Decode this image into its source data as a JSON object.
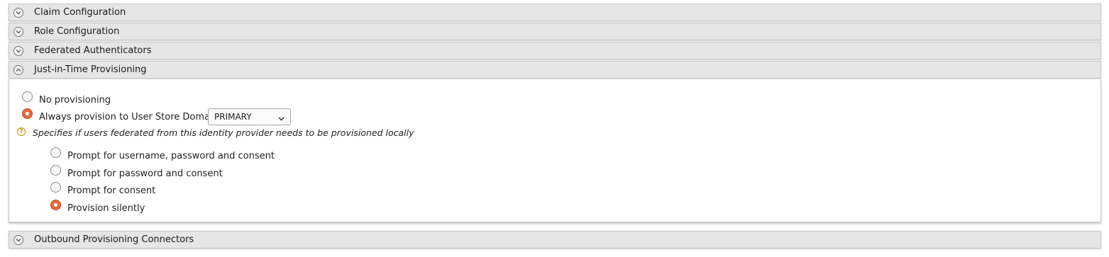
{
  "panels": {
    "claim": {
      "label": "Claim Configuration",
      "state": "collapsed"
    },
    "role": {
      "label": "Role Configuration",
      "state": "collapsed"
    },
    "federated": {
      "label": "Federated Authenticators",
      "state": "collapsed"
    },
    "jit": {
      "label": "Just-in-Time Provisioning",
      "state": "expanded"
    },
    "outbound": {
      "label": "Outbound Provisioning Connectors",
      "state": "collapsed"
    }
  },
  "jit": {
    "no_provisioning_label": "No provisioning",
    "always_provision_label": "Always provision to User Store Domain",
    "user_store_domain": "PRIMARY",
    "help_text": "Specifies if users federated from this identity provider needs to be provisioned locally",
    "selected_mode": "always_provision",
    "options": [
      {
        "label": "Prompt for username, password and consent",
        "checked": false
      },
      {
        "label": "Prompt for password and consent",
        "checked": false
      },
      {
        "label": "Prompt for consent",
        "checked": false
      },
      {
        "label": "Provision silently",
        "checked": true
      }
    ]
  },
  "colors": {
    "radio_checked": "#e46b3b",
    "header_bg": "#e6e6e6",
    "help_icon": "#c4900c"
  },
  "icons": {
    "collapsed": "chevron-down-icon",
    "expanded": "chevron-up-icon",
    "help": "help-icon"
  }
}
